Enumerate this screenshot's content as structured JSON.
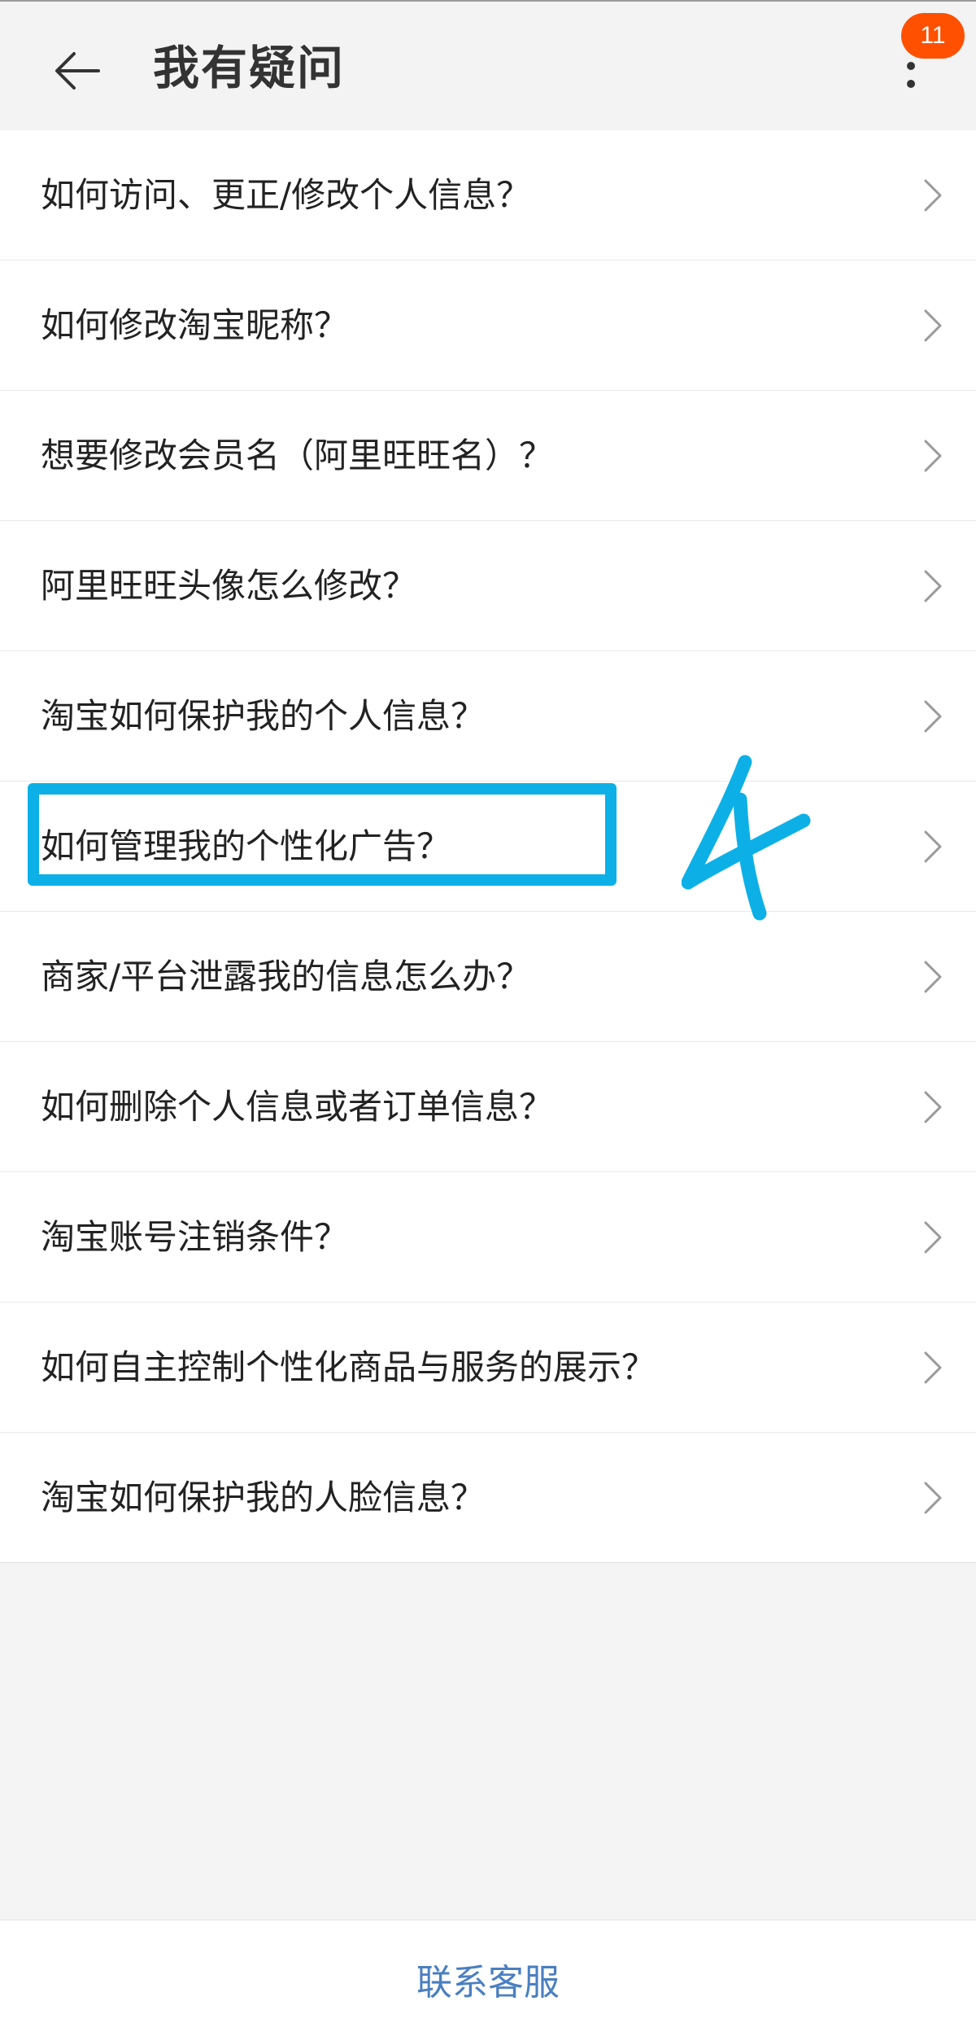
{
  "header": {
    "title": "我有疑问",
    "back_icon": "arrow-left-icon",
    "more_icon": "more-vertical-icon",
    "badge_count": "11",
    "badge_color": "#ff5000"
  },
  "faq": {
    "items": [
      {
        "label": "如何访问、更正/修改个人信息？"
      },
      {
        "label": "如何修改淘宝昵称？"
      },
      {
        "label": "想要修改会员名（阿里旺旺名）？"
      },
      {
        "label": "阿里旺旺头像怎么修改？"
      },
      {
        "label": "淘宝如何保护我的个人信息？"
      },
      {
        "label": "如何管理我的个性化广告？"
      },
      {
        "label": "商家/平台泄露我的信息怎么办？"
      },
      {
        "label": "如何删除个人信息或者订单信息？"
      },
      {
        "label": "淘宝账号注销条件？"
      },
      {
        "label": "如何自主控制个性化商品与服务的展示？"
      },
      {
        "label": "淘宝如何保护我的人脸信息？"
      }
    ],
    "chevron_icon": "chevron-right-icon"
  },
  "annotation": {
    "highlighted_item": "如何管理我的个性化广告？",
    "handwritten_label": "4",
    "color": "#0cb0e6"
  },
  "footer": {
    "contact_label": "联系客服",
    "contact_color": "#4a7fc1"
  }
}
